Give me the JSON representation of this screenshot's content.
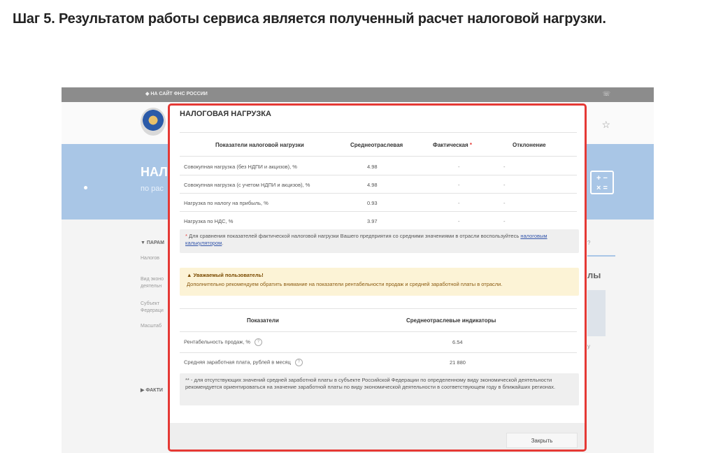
{
  "step_title": "Шаг 5. Результатом работы сервиса является полученный расчет налоговой нагрузки.",
  "site": {
    "back_link": "◆ НА САЙТ ФНС РОССИИ",
    "banner_title": "НАЛ",
    "banner_sub": "по рас",
    "left_panel": {
      "params_header": "▼ ПАРАМ",
      "item1": "Налогов",
      "item2a": "Вид эконо",
      "item2b": "деятельн",
      "item3a": "Субъект",
      "item3b": "Федераци",
      "item4": "Масштаб",
      "fact_header": "▶ ФАКТИ"
    },
    "right_panel": {
      "q": "?",
      "big": "лы",
      "txt": "у"
    }
  },
  "modal": {
    "title": "НАЛОГОВАЯ НАГРУЗКА",
    "table1": {
      "headers": [
        "Показатели налоговой нагрузки",
        "Среднеотраслевая",
        "Фактическая",
        "Отклонение"
      ],
      "required_mark": "*",
      "rows": [
        {
          "label": "Совокупная нагрузка (без НДПИ и акцизов), %",
          "avg": "4.98",
          "actual": "-",
          "dev": "-"
        },
        {
          "label": "Совокупная нагрузка (с учетом НДПИ и акцизов), %",
          "avg": "4.98",
          "actual": "-",
          "dev": "-"
        },
        {
          "label": "Нагрузка по налогу на прибыль, %",
          "avg": "0.93",
          "actual": "-",
          "dev": "-"
        },
        {
          "label": "Нагрузка по НДС, %",
          "avg": "3.97",
          "actual": "-",
          "dev": "-"
        }
      ]
    },
    "note1": {
      "star": "*",
      "text": " Для сравнения показателей фактической налоговой нагрузки Вашего предприятия со средними значениями в отрасли воспользуйтесь ",
      "link": "налоговым калькулятором",
      "end": "."
    },
    "warning": {
      "title": "Уважаемый пользователь!",
      "body": "Дополнительно рекомендуем обратить внимание на показатели рентабельности продаж и средней заработной платы в отрасли."
    },
    "table2": {
      "headers": [
        "Показатели",
        "Среднеотраслевые индикаторы"
      ],
      "rows": [
        {
          "label": "Рентабельность продаж, %",
          "value": "6.54",
          "help": "?"
        },
        {
          "label": "Средняя заработная плата, рублей в месяц",
          "value": "21 880",
          "help": "?"
        }
      ]
    },
    "note2": "** - для отсутствующих значений средней заработной платы в субъекте Российской Федерации по определенному виду экономической деятельности рекомендуется ориентироваться на значение заработной платы по виду экономической деятельности в соответствующем году в ближайших регионах.",
    "close_label": "Закрыть"
  }
}
